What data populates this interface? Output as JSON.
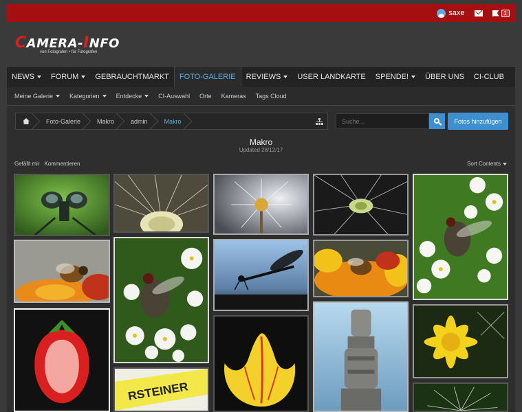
{
  "topbar": {
    "username": "saxe",
    "notifications_count": "1",
    "icons": [
      "user-avatar-icon",
      "mail-icon",
      "flag-icon"
    ]
  },
  "logo": {
    "text_c": "C",
    "text_amera": "AMERA-",
    "text_i": "I",
    "text_nfo": "NFO",
    "tagline": "von Fotografen • für Fotografen"
  },
  "main_nav": [
    {
      "label": "NEWS",
      "dropdown": true
    },
    {
      "label": "FORUM",
      "dropdown": true
    },
    {
      "label": "GEBRAUCHTMARKT",
      "dropdown": false
    },
    {
      "label": "FOTO-GALERIE",
      "dropdown": false,
      "active": true
    },
    {
      "label": "REVIEWS",
      "dropdown": true
    },
    {
      "label": "USER LANDKARTE",
      "dropdown": false
    },
    {
      "label": "SPENDE!",
      "dropdown": true
    },
    {
      "label": "ÜBER UNS",
      "dropdown": false
    },
    {
      "label": "CI-CLUB",
      "dropdown": false
    }
  ],
  "sub_nav": [
    {
      "label": "Meine Galerie",
      "dropdown": true
    },
    {
      "label": "Kategorien",
      "dropdown": true
    },
    {
      "label": "Entdecke",
      "dropdown": true
    },
    {
      "label": "CI-Auswahl",
      "dropdown": false
    },
    {
      "label": "Orte",
      "dropdown": false
    },
    {
      "label": "Kameras",
      "dropdown": false
    },
    {
      "label": "Tags Cloud",
      "dropdown": false
    }
  ],
  "breadcrumb": [
    "Foto-Galerie",
    "Makro",
    "admin",
    "Makro"
  ],
  "search": {
    "placeholder": "Suche..."
  },
  "add_button": "Fotos hinzufügen",
  "album": {
    "title": "Makro",
    "updated": "Updated 28/12/17"
  },
  "actions": {
    "like": "Gefällt mir",
    "comment": "Kommentieren"
  },
  "sort_label": "Sort Contents",
  "colors": {
    "topbar": "#a50f0f",
    "accent": "#3d8fd0",
    "active_nav": "#5bb0e8"
  },
  "photos": [
    {
      "subject": "damselfly-head"
    },
    {
      "subject": "dandelion-seedhead-closeup"
    },
    {
      "subject": "dandelion-clock"
    },
    {
      "subject": "dandelion-seeds-center"
    },
    {
      "subject": "fly-on-white-flowers"
    },
    {
      "subject": "bee-on-marigold"
    },
    {
      "subject": "fly-on-white-blossoms"
    },
    {
      "subject": "damselfly-silhouette"
    },
    {
      "subject": "bee-on-orange-flower"
    },
    {
      "subject": "strawberry-half"
    },
    {
      "subject": "yellow-tulip"
    },
    {
      "subject": "water-tap"
    },
    {
      "subject": "yellow-dandelion"
    },
    {
      "subject": "yellow-marker-pen"
    },
    {
      "subject": "dandelion-puff"
    }
  ],
  "pen_text": "RSTEINER"
}
